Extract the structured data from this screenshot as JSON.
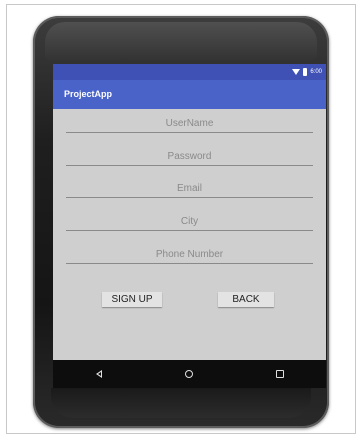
{
  "status_bar": {
    "time": "6:00",
    "icons": [
      "wifi-icon",
      "battery-icon"
    ],
    "color": "#3f51b5"
  },
  "app_bar": {
    "title": "ProjectApp",
    "color": "#4a63c9"
  },
  "form": {
    "fields": [
      {
        "placeholder": "UserName"
      },
      {
        "placeholder": "Password"
      },
      {
        "placeholder": "Email"
      },
      {
        "placeholder": "City"
      },
      {
        "placeholder": "Phone Number"
      }
    ],
    "buttons": {
      "sign_up": "SIGN UP",
      "back": "BACK"
    }
  },
  "nav_bar": {
    "icons": [
      "back-icon",
      "home-icon",
      "recent-apps-icon"
    ]
  }
}
